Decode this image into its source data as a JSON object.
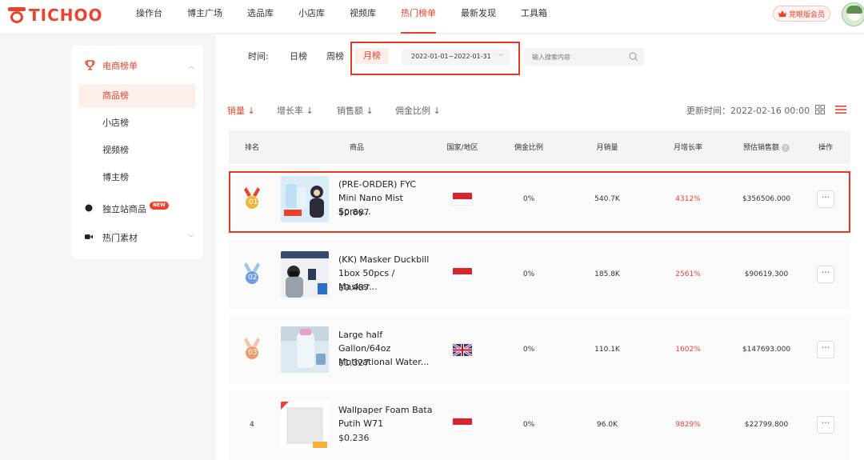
{
  "brand": {
    "name": "TICHOO",
    "accent": "#e8432e"
  },
  "nav": {
    "items": [
      "操作台",
      "博主广场",
      "选品库",
      "小店库",
      "视频库",
      "热门榜单",
      "最新发现",
      "工具箱"
    ],
    "active": "热门榜单",
    "vip_label": "竞眼版会员"
  },
  "sidebar": {
    "section": {
      "label": "电商榜单",
      "icon": "trophy-icon"
    },
    "sub_items": [
      "商品榜",
      "小店榜",
      "视频榜",
      "博主榜"
    ],
    "active_sub": "商品榜",
    "main_items": [
      {
        "label": "独立站商品",
        "badge": "NEW",
        "icon": "dot-icon"
      },
      {
        "label": "热门素材",
        "icon": "video-icon"
      }
    ]
  },
  "filter": {
    "label": "时间:",
    "options": [
      "日榜",
      "周榜",
      "月榜"
    ],
    "active": "月榜",
    "date_range": "2022-01-01~2022-01-31",
    "search_placeholder": "输入搜索内容"
  },
  "sort": {
    "options": [
      "销量 ↓",
      "增长率 ↓",
      "销售额 ↓",
      "佣金比例 ↓"
    ],
    "active": "销量 ↓",
    "updated": "更新时间：2022-02-16 00:00"
  },
  "table": {
    "headers": [
      "排名",
      "商品",
      "国家/地区",
      "佣金比例",
      "月销量",
      "月增长率",
      "预估销售额",
      "操作"
    ],
    "rows": [
      {
        "rank": "01",
        "medal_color": "#e9b83a",
        "name": "(PRE-ORDER) FYC Mini Nano Mist Spray...",
        "price": "$0.667",
        "country": "id",
        "commission": "0%",
        "sales": "540.7K",
        "growth": "4312%",
        "revenue": "$356506.000",
        "op": "···"
      },
      {
        "rank": "02",
        "medal_color": "#6f9be8",
        "name": "(KK) Masker Duckbill 1box 50pcs / Masker...",
        "price": "$0.487",
        "country": "id",
        "commission": "0%",
        "sales": "185.8K",
        "growth": "2561%",
        "revenue": "$90619.300",
        "op": "···"
      },
      {
        "rank": "03",
        "medal_color": "#f09a6c",
        "name": "Large half Gallon/64oz Motivational Water...",
        "price": "$1.327",
        "country": "gb",
        "commission": "0%",
        "sales": "110.1K",
        "growth": "1602%",
        "revenue": "$147693.000",
        "op": "···"
      },
      {
        "rank": "4",
        "medal_color": "",
        "name": "Wallpaper Foam Bata Putih W71",
        "price": "$0.236",
        "country": "id",
        "commission": "0%",
        "sales": "96.0K",
        "growth": "9829%",
        "revenue": "$22799.800",
        "op": "···"
      }
    ]
  }
}
